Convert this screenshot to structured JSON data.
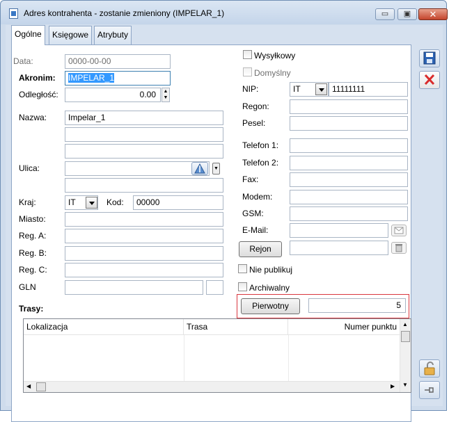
{
  "window": {
    "title": "Adres kontrahenta - zostanie zmieniony (IMPELAR_1)",
    "minimize": "▭",
    "maximize": "▣",
    "close": "✕"
  },
  "tabs": [
    "Ogólne",
    "Księgowe",
    "Atrybuty"
  ],
  "left": {
    "data_label": "Data:",
    "data_value": "0000-00-00",
    "akronim_label": "Akronim:",
    "akronim_value": "IMPELAR_1",
    "odleglosc_label": "Odległość:",
    "odleglosc_value": "0.00",
    "nazwa_label": "Nazwa:",
    "nazwa_value": "Impelar_1",
    "ulica_label": "Ulica:",
    "kraj_label": "Kraj:",
    "kraj_value": "IT",
    "kod_label": "Kod:",
    "kod_value": "00000",
    "miasto_label": "Miasto:",
    "rega_label": "Reg. A:",
    "regb_label": "Reg. B:",
    "regc_label": "Reg. C:",
    "gln_label": "GLN"
  },
  "right": {
    "wysylkowy_label": "Wysyłkowy",
    "domyslny_label": "Domyślny",
    "nip_label": "NIP:",
    "nip_country": "IT",
    "nip_value": "11111111",
    "regon_label": "Regon:",
    "pesel_label": "Pesel:",
    "tel1_label": "Telefon 1:",
    "tel2_label": "Telefon 2:",
    "fax_label": "Fax:",
    "modem_label": "Modem:",
    "gsm_label": "GSM:",
    "email_label": "E-Mail:",
    "rejon_button": "Rejon",
    "nie_publikuj_label": "Nie publikuj",
    "archiwalny_label": "Archiwalny",
    "pierwotny_button": "Pierwotny",
    "pierwotny_value": "5"
  },
  "trasy": {
    "title": "Trasy:",
    "columns": [
      "Lokalizacja",
      "Trasa",
      "Numer punktu"
    ]
  },
  "icons": {
    "save": "save-icon",
    "delete": "delete-icon",
    "lock": "lock-icon",
    "pin": "pin-icon",
    "map": "map-icon",
    "mail": "mail-icon",
    "trash": "trash-icon"
  },
  "colors": {
    "selection": "#3399ff",
    "highlight_border": "#d9363e",
    "window_bg": "#d6e1ef"
  }
}
